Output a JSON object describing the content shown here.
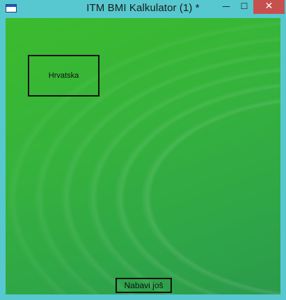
{
  "window": {
    "title": "ITM BMI Kalkulator (1) *",
    "controls": {
      "minimize": "—",
      "maximize": "☐",
      "close": "✕"
    },
    "colors": {
      "frame": "#57c8cf",
      "close_button": "#c7504f",
      "client_background": "#35b33c"
    }
  },
  "main": {
    "country_label": "Hrvatska",
    "buy_button_label": "Nabavi još"
  }
}
